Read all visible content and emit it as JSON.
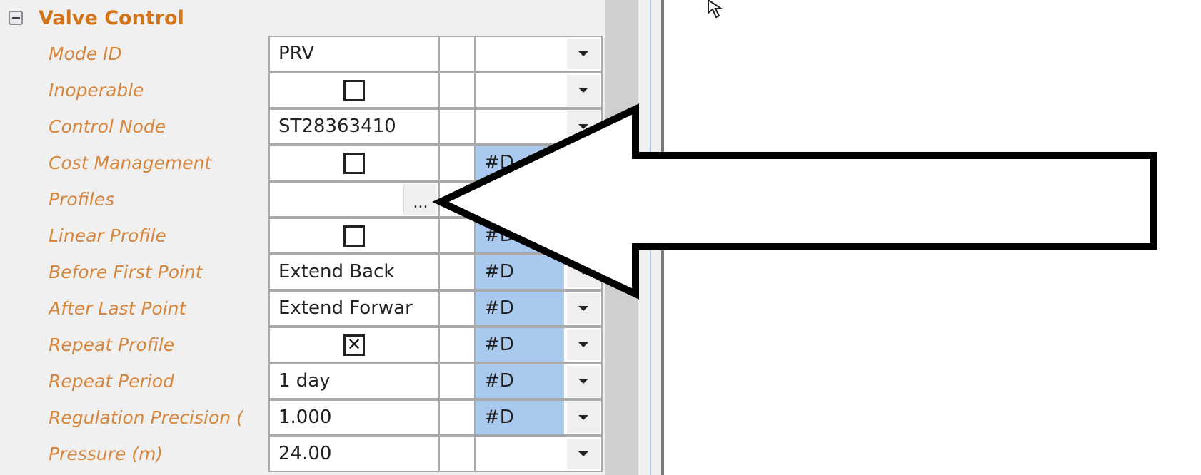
{
  "group": {
    "title": "Valve Control",
    "collapse_icon": "minus-box-icon"
  },
  "rows": [
    {
      "label": "Mode ID",
      "value": "PRV",
      "type": "text",
      "option": "",
      "option_highlight": false,
      "dropdown": true
    },
    {
      "label": "Inoperable",
      "value": "",
      "type": "checkbox",
      "checked": false,
      "option": "",
      "option_highlight": false,
      "dropdown": true
    },
    {
      "label": "Control Node",
      "value": "ST28363410",
      "type": "text",
      "option": "",
      "option_highlight": false,
      "dropdown": true
    },
    {
      "label": "Cost Management",
      "value": "",
      "type": "checkbox",
      "checked": false,
      "option": "#D",
      "option_highlight": true,
      "dropdown": true
    },
    {
      "label": "Profiles",
      "value": "",
      "type": "ellipsis",
      "ellipsis_label": "...",
      "option": "",
      "option_highlight": false,
      "dropdown": false
    },
    {
      "label": "Linear Profile",
      "value": "",
      "type": "checkbox",
      "checked": false,
      "option": "#D",
      "option_highlight": true,
      "dropdown": true
    },
    {
      "label": "Before First Point",
      "value": "Extend Back",
      "type": "text",
      "option": "#D",
      "option_highlight": true,
      "dropdown": true
    },
    {
      "label": "After Last Point",
      "value": "Extend Forwar",
      "type": "text",
      "option": "#D",
      "option_highlight": true,
      "dropdown": true
    },
    {
      "label": "Repeat Profile",
      "value": "",
      "type": "checkbox",
      "checked": true,
      "option": "#D",
      "option_highlight": true,
      "dropdown": true
    },
    {
      "label": "Repeat Period",
      "value": "1 day",
      "type": "text",
      "option": "#D",
      "option_highlight": true,
      "dropdown": true
    },
    {
      "label": "Regulation Precision (",
      "value": "1.000",
      "type": "text",
      "option": "#D",
      "option_highlight": true,
      "dropdown": true
    },
    {
      "label": "Pressure (m)",
      "value": "24.00",
      "type": "text",
      "option": "",
      "option_highlight": false,
      "dropdown": true
    }
  ],
  "annotation": {
    "arrow_icon": "large-left-arrow-callout-icon",
    "points_to": "Profiles"
  },
  "cursor_icon": "mouse-pointer-icon",
  "colors": {
    "label": "#d7853a",
    "group_title": "#d2741a",
    "highlight": "#a9c9ee"
  }
}
